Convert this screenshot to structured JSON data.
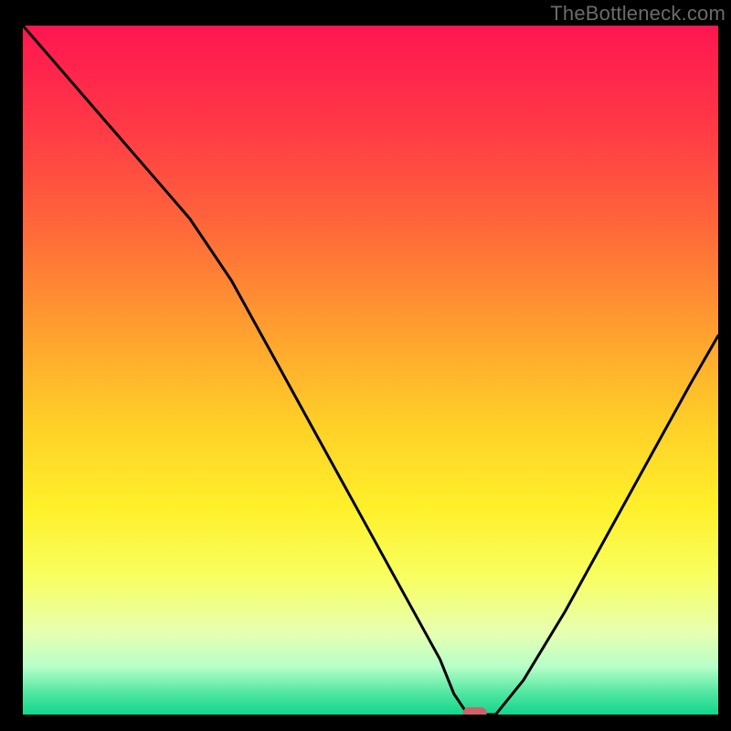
{
  "watermark": "TheBottleneck.com",
  "marker": {
    "color": "#cf6169"
  },
  "chart_data": {
    "type": "line",
    "title": "",
    "xlabel": "",
    "ylabel": "",
    "xlim": [
      0,
      100
    ],
    "ylim": [
      0,
      100
    ],
    "grid": false,
    "legend": false,
    "annotations": [],
    "series": [
      {
        "name": "curve",
        "x": [
          0,
          6,
          12,
          18,
          24,
          30,
          36,
          42,
          48,
          54,
          60,
          62,
          64,
          66,
          68,
          72,
          78,
          84,
          90,
          96,
          100
        ],
        "values": [
          100,
          93,
          86,
          79,
          72,
          63,
          52,
          41,
          30,
          19,
          8,
          3,
          0,
          0,
          0,
          5,
          15,
          26,
          37,
          48,
          55
        ]
      }
    ],
    "marker_x": 65,
    "marker_y": 0,
    "gradient_stops": [
      {
        "offset": 0.0,
        "color": "#ff1550"
      },
      {
        "offset": 0.15,
        "color": "#ff3a46"
      },
      {
        "offset": 0.3,
        "color": "#ff6a39"
      },
      {
        "offset": 0.45,
        "color": "#ffa22f"
      },
      {
        "offset": 0.58,
        "color": "#ffd028"
      },
      {
        "offset": 0.7,
        "color": "#fff02a"
      },
      {
        "offset": 0.8,
        "color": "#f8ff60"
      },
      {
        "offset": 0.88,
        "color": "#e8ffb0"
      },
      {
        "offset": 0.93,
        "color": "#b8ffc8"
      },
      {
        "offset": 0.97,
        "color": "#4de6a0"
      },
      {
        "offset": 1.0,
        "color": "#12d68c"
      }
    ]
  }
}
